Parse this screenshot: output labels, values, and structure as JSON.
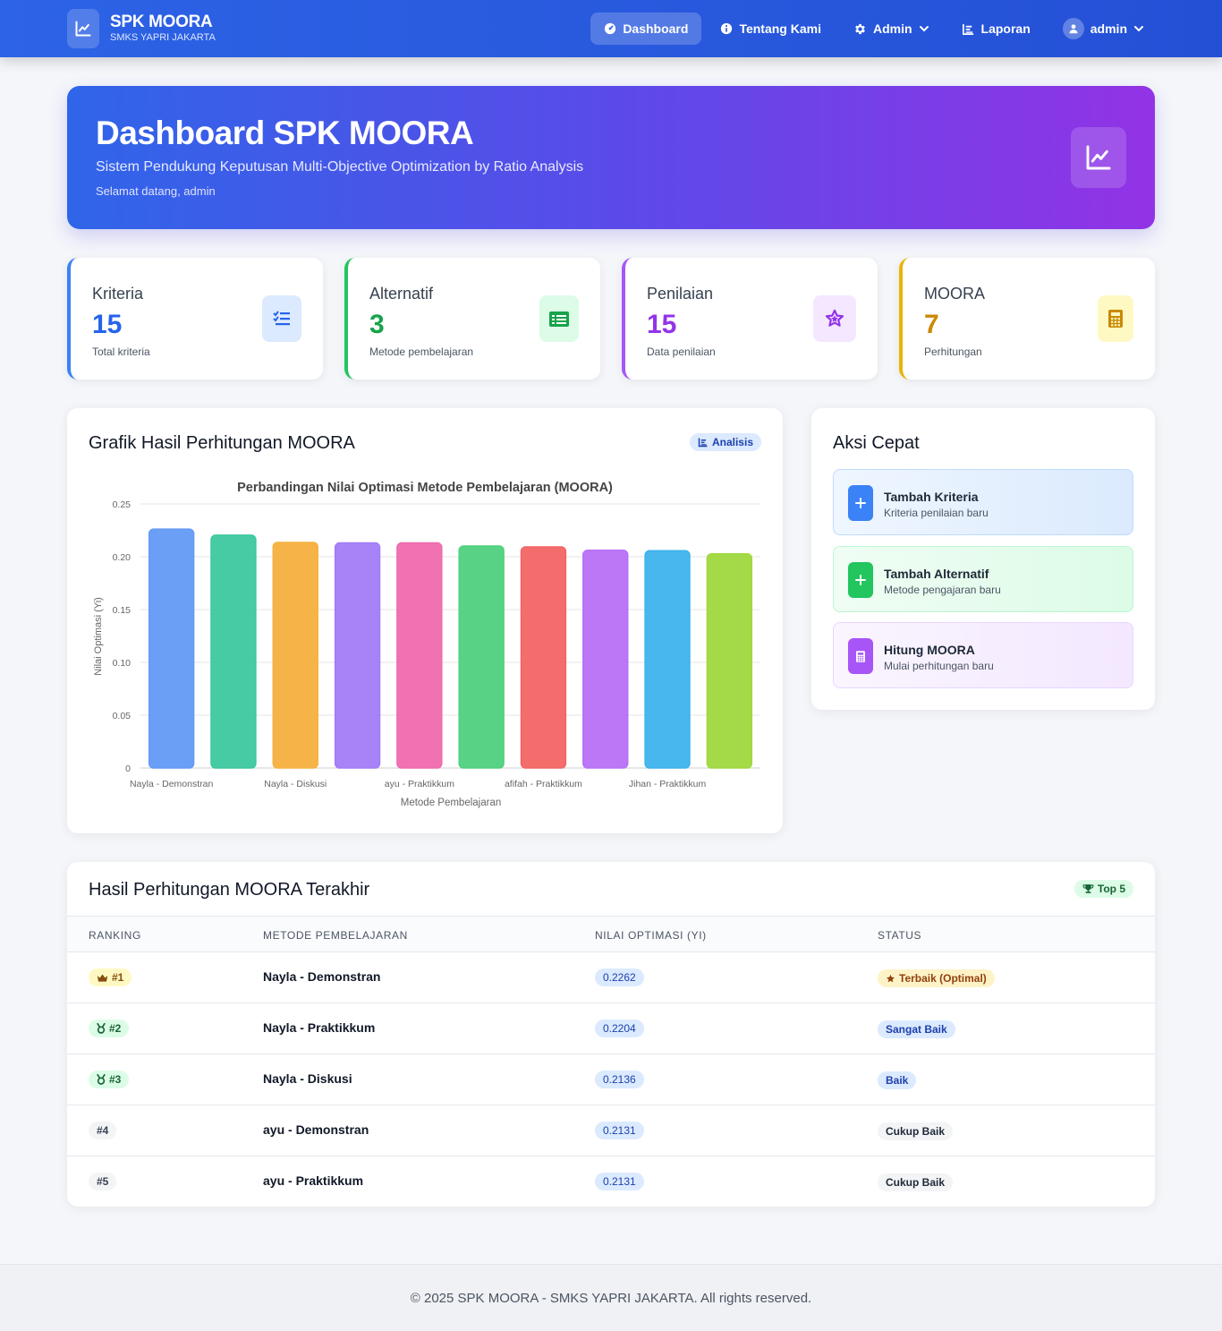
{
  "brand": {
    "title": "SPK MOORA",
    "subtitle": "SMKS YAPRI JAKARTA"
  },
  "nav": {
    "dashboard": "Dashboard",
    "about": "Tentang Kami",
    "admin": "Admin",
    "report": "Laporan",
    "user": "admin"
  },
  "hero": {
    "title": "Dashboard SPK MOORA",
    "subtitle": "Sistem Pendukung Keputusan Multi-Objective Optimization by Ratio Analysis",
    "welcome": "Selamat datang, admin"
  },
  "stats": [
    {
      "label": "Kriteria",
      "value": "15",
      "desc": "Total kriteria",
      "color": "#2563eb",
      "icon": "list-check-icon"
    },
    {
      "label": "Alternatif",
      "value": "3",
      "desc": "Metode pembelajaran",
      "color": "#16a34a",
      "icon": "list-icon"
    },
    {
      "label": "Penilaian",
      "value": "15",
      "desc": "Data penilaian",
      "color": "#9333ea",
      "icon": "star-icon"
    },
    {
      "label": "MOORA",
      "value": "7",
      "desc": "Perhitungan",
      "color": "#ca8a04",
      "icon": "calculator-icon"
    }
  ],
  "chart_card": {
    "title": "Grafik Hasil Perhitungan MOORA",
    "badge": "Analisis"
  },
  "chart_data": {
    "type": "bar",
    "title": "Perbandingan Nilai Optimasi Metode Pembelajaran (MOORA)",
    "xlabel": "Metode Pembelajaran",
    "ylabel": "Nilai Optimasi (Yi)",
    "ylim": [
      0,
      0.25
    ],
    "yticks": [
      "0",
      "0.05",
      "0.10",
      "0.15",
      "0.20",
      "0.25"
    ],
    "grid": true,
    "legend": "none",
    "visible_xtick_labels": [
      "Nayla - Demonstran",
      "Nayla - Diskusi",
      "ayu  - Praktikkum",
      "afifah - Praktikkum",
      "Jihan - Praktikkum"
    ],
    "xtick_label_bar_index": [
      0,
      2,
      4,
      6,
      8
    ],
    "values": [
      0.2262,
      0.2204,
      0.2136,
      0.2131,
      0.2131,
      0.2102,
      0.2093,
      0.2061,
      0.2057,
      0.2028
    ],
    "colors": [
      "#639af5",
      "#3cc8a0",
      "#f6b03e",
      "#a27cf7",
      "#ef6aae",
      "#4fd07d",
      "#f26565",
      "#b770f6",
      "#3db3ec",
      "#9fd83e"
    ]
  },
  "quick": {
    "title": "Aksi Cepat",
    "items": [
      {
        "title": "Tambah Kriteria",
        "desc": "Kriteria penilaian baru"
      },
      {
        "title": "Tambah Alternatif",
        "desc": "Metode pengajaran baru"
      },
      {
        "title": "Hitung MOORA",
        "desc": "Mulai perhitungan baru"
      }
    ]
  },
  "results": {
    "title": "Hasil Perhitungan MOORA Terakhir",
    "badge": "Top 5",
    "headers": [
      "RANKING",
      "METODE PEMBELAJARAN",
      "NILAI OPTIMASI (YI)",
      "STATUS"
    ],
    "rows": [
      {
        "rank": "#1",
        "method": "Nayla - Demonstran",
        "score": "0.2262",
        "status": "Terbaik (Optimal)"
      },
      {
        "rank": "#2",
        "method": "Nayla - Praktikkum",
        "score": "0.2204",
        "status": "Sangat Baik"
      },
      {
        "rank": "#3",
        "method": "Nayla - Diskusi",
        "score": "0.2136",
        "status": "Baik"
      },
      {
        "rank": "#4",
        "method": "ayu - Demonstran",
        "score": "0.2131",
        "status": "Cukup Baik"
      },
      {
        "rank": "#5",
        "method": "ayu - Praktikkum",
        "score": "0.2131",
        "status": "Cukup Baik"
      }
    ]
  },
  "footer": "© 2025 SPK MOORA - SMKS YAPRI JAKARTA. All rights reserved."
}
